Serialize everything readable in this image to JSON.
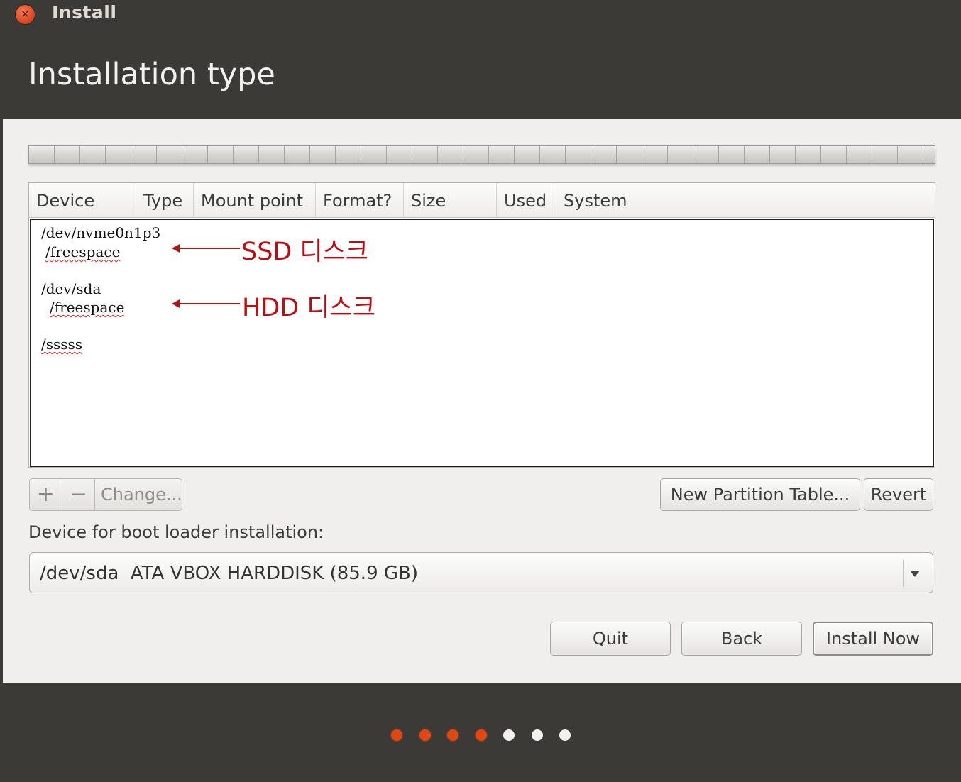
{
  "window": {
    "title": "Install",
    "page_title": "Installation type",
    "close_symbol": "✕"
  },
  "table": {
    "columns": [
      "Device",
      "Type",
      "Mount point",
      "Format?",
      "Size",
      "Used",
      "System"
    ],
    "rows": [
      {
        "text": "/dev/nvme0n1p3"
      },
      {
        "text": "/freespace"
      },
      {
        "text": "/dev/sda"
      },
      {
        "text": "/freespace"
      },
      {
        "text": "/sssss"
      }
    ]
  },
  "annotations": {
    "ssd": "SSD 디스크",
    "hdd": "HDD 디스크",
    "color": "#b80f14"
  },
  "toolbar": {
    "add_label": "+",
    "remove_label": "−",
    "change_label": "Change...",
    "new_partition_table_label": "New Partition Table...",
    "revert_label": "Revert"
  },
  "boot_loader": {
    "label": "Device for boot loader installation:",
    "selected_value": "/dev/sda  ATA VBOX HARDDISK (85.9 GB)"
  },
  "buttons": {
    "quit": "Quit",
    "back": "Back",
    "install_now": "Install Now"
  },
  "progress": {
    "total_steps": 7,
    "completed_steps": 4,
    "active_color": "#dd4814",
    "inactive_color": "#f2f1ef"
  }
}
